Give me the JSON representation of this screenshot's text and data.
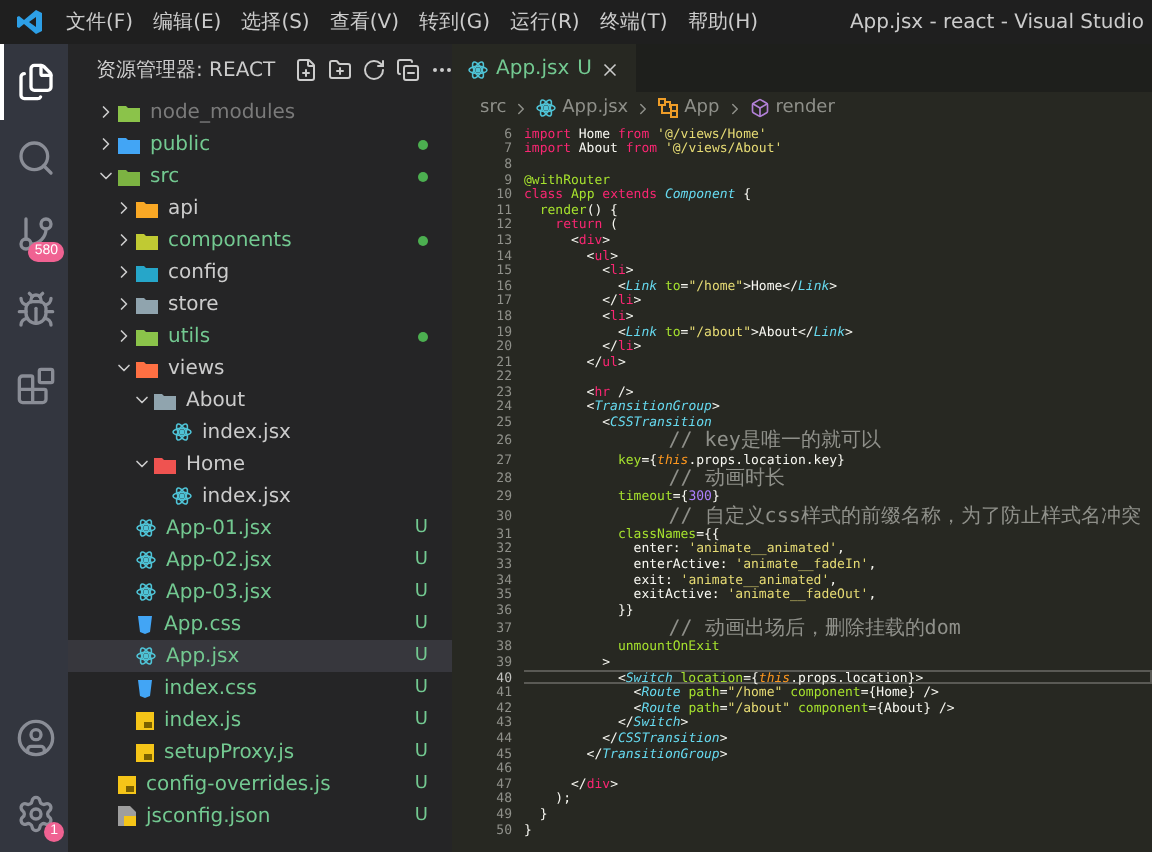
{
  "titlebar": {
    "menu": [
      "文件(F)",
      "编辑(E)",
      "选择(S)",
      "查看(V)",
      "转到(G)",
      "运行(R)",
      "终端(T)",
      "帮助(H)"
    ],
    "title": "App.jsx - react - Visual Studio"
  },
  "activity_bar": {
    "items": [
      {
        "kind": "explorer",
        "selected": true
      },
      {
        "kind": "search",
        "selected": false
      },
      {
        "kind": "source-control",
        "selected": false,
        "badge": "580"
      },
      {
        "kind": "debug",
        "selected": false
      },
      {
        "kind": "extensions",
        "selected": false
      }
    ],
    "bottom": [
      {
        "kind": "account"
      },
      {
        "kind": "settings",
        "badge": "1"
      }
    ]
  },
  "explorer": {
    "title": "资源管理器: REACT",
    "tree": [
      {
        "name": "node_modules",
        "kind": "folder",
        "color": "#8bc34a",
        "ignored": true,
        "changed": false,
        "expanded": false,
        "selected": false
      },
      {
        "name": "public",
        "kind": "folder",
        "color": "#42a5f5",
        "ignored": false,
        "changed": true,
        "expanded": false,
        "selected": false
      },
      {
        "name": "src",
        "kind": "folder",
        "color": "#7cb342",
        "ignored": false,
        "changed": true,
        "expanded": true,
        "selected": false,
        "children": [
          {
            "name": "api",
            "kind": "folder",
            "color": "#f9a825",
            "ignored": false,
            "changed": false,
            "expanded": false,
            "selected": false
          },
          {
            "name": "components",
            "kind": "folder",
            "color": "#c0ca33",
            "ignored": false,
            "changed": true,
            "expanded": false,
            "selected": false
          },
          {
            "name": "config",
            "kind": "folder",
            "color": "#26a6c9",
            "ignored": false,
            "changed": false,
            "expanded": false,
            "selected": false
          },
          {
            "name": "store",
            "kind": "folder",
            "color": "#90a4ae",
            "ignored": false,
            "changed": false,
            "expanded": false,
            "selected": false
          },
          {
            "name": "utils",
            "kind": "folder",
            "color": "#8bc34a",
            "ignored": false,
            "changed": true,
            "expanded": false,
            "selected": false
          },
          {
            "name": "views",
            "kind": "folder",
            "color": "#ff7043",
            "ignored": false,
            "changed": false,
            "expanded": true,
            "selected": false,
            "children": [
              {
                "name": "About",
                "kind": "folder",
                "color": "#90a4ae",
                "ignored": false,
                "changed": false,
                "expanded": true,
                "selected": false,
                "children": [
                  {
                    "name": "index.jsx",
                    "kind": "react",
                    "ignored": false,
                    "changed": false,
                    "selected": false
                  }
                ]
              },
              {
                "name": "Home",
                "kind": "folder",
                "color": "#ef5350",
                "ignored": false,
                "changed": false,
                "expanded": true,
                "selected": false,
                "children": [
                  {
                    "name": "index.jsx",
                    "kind": "react",
                    "ignored": false,
                    "changed": false,
                    "selected": false
                  }
                ]
              }
            ]
          },
          {
            "name": "App-01.jsx",
            "kind": "react",
            "ignored": false,
            "changed": true,
            "badge": "U",
            "selected": false
          },
          {
            "name": "App-02.jsx",
            "kind": "react",
            "ignored": false,
            "changed": true,
            "badge": "U",
            "selected": false
          },
          {
            "name": "App-03.jsx",
            "kind": "react",
            "ignored": false,
            "changed": true,
            "badge": "U",
            "selected": false
          },
          {
            "name": "App.css",
            "kind": "css",
            "ignored": false,
            "changed": true,
            "badge": "U",
            "selected": false
          },
          {
            "name": "App.jsx",
            "kind": "react",
            "ignored": false,
            "changed": true,
            "badge": "U",
            "selected": true
          },
          {
            "name": "index.css",
            "kind": "css",
            "ignored": false,
            "changed": true,
            "badge": "U",
            "selected": false
          },
          {
            "name": "index.js",
            "kind": "js",
            "ignored": false,
            "changed": true,
            "badge": "U",
            "selected": false
          },
          {
            "name": "setupProxy.js",
            "kind": "js",
            "ignored": false,
            "changed": true,
            "badge": "U",
            "selected": false
          }
        ]
      },
      {
        "name": "config-overrides.js",
        "kind": "js",
        "ignored": false,
        "changed": true,
        "badge": "U",
        "selected": false
      },
      {
        "name": "jsconfig.json",
        "kind": "json",
        "ignored": false,
        "changed": true,
        "badge": "U",
        "selected": false
      }
    ]
  },
  "editor": {
    "tabs": [
      {
        "label": "App.jsx",
        "badge": "U",
        "selected": true
      }
    ],
    "breadcrumb": [
      {
        "kind": "folder",
        "label": "src"
      },
      {
        "kind": "react",
        "label": "App.jsx"
      },
      {
        "kind": "class",
        "label": "App"
      },
      {
        "kind": "method",
        "label": "render"
      }
    ],
    "lines": [
      {
        "n": "6",
        "current": false,
        "tokens": [
          {
            "kind": "kw",
            "text": "import"
          },
          {
            "kind": "plain",
            "text": " Home "
          },
          {
            "kind": "kw",
            "text": "from"
          },
          {
            "kind": "str",
            "text": " '@/views/Home'"
          }
        ]
      },
      {
        "n": "7",
        "current": false,
        "tokens": [
          {
            "kind": "kw",
            "text": "import"
          },
          {
            "kind": "plain",
            "text": " About "
          },
          {
            "kind": "kw",
            "text": "from"
          },
          {
            "kind": "str",
            "text": " '@/views/About'"
          }
        ]
      },
      {
        "n": "8",
        "current": false
      },
      {
        "n": "9",
        "current": false,
        "tokens": [
          {
            "kind": "deco",
            "text": "@withRouter"
          }
        ]
      },
      {
        "n": "10",
        "current": false,
        "tokens": [
          {
            "kind": "kw",
            "text": "class"
          },
          {
            "kind": "cls",
            "text": " App "
          },
          {
            "kind": "kw",
            "text": "extends"
          },
          {
            "kind": "comp",
            "text": " Component"
          },
          {
            "kind": "plain",
            "text": " {"
          }
        ]
      },
      {
        "n": "11",
        "current": false,
        "tokens": [
          {
            "kind": "fn",
            "text": "  render"
          },
          {
            "kind": "plain",
            "text": "() {"
          }
        ]
      },
      {
        "n": "12",
        "current": false,
        "tokens": [
          {
            "kind": "kw",
            "text": "    return"
          },
          {
            "kind": "plain",
            "text": " ("
          }
        ]
      },
      {
        "n": "13",
        "current": false,
        "tokens": [
          {
            "kind": "plain",
            "text": "      <"
          },
          {
            "kind": "tag",
            "text": "div"
          },
          {
            "kind": "plain",
            "text": ">"
          }
        ]
      },
      {
        "n": "14",
        "current": false,
        "tokens": [
          {
            "kind": "plain",
            "text": "        <"
          },
          {
            "kind": "tag",
            "text": "ul"
          },
          {
            "kind": "plain",
            "text": ">"
          }
        ]
      },
      {
        "n": "15",
        "current": false,
        "tokens": [
          {
            "kind": "plain",
            "text": "          <"
          },
          {
            "kind": "tag",
            "text": "li"
          },
          {
            "kind": "plain",
            "text": ">"
          }
        ]
      },
      {
        "n": "16",
        "current": false,
        "tokens": [
          {
            "kind": "plain",
            "text": "            <"
          },
          {
            "kind": "comp",
            "text": "Link"
          },
          {
            "kind": "attr",
            "text": " to"
          },
          {
            "kind": "plain",
            "text": "="
          },
          {
            "kind": "str",
            "text": "\"/home\""
          },
          {
            "kind": "plain",
            "text": ">Home</"
          },
          {
            "kind": "comp",
            "text": "Link"
          },
          {
            "kind": "plain",
            "text": ">"
          }
        ]
      },
      {
        "n": "17",
        "current": false,
        "tokens": [
          {
            "kind": "plain",
            "text": "          </"
          },
          {
            "kind": "tag",
            "text": "li"
          },
          {
            "kind": "plain",
            "text": ">"
          }
        ]
      },
      {
        "n": "18",
        "current": false,
        "tokens": [
          {
            "kind": "plain",
            "text": "          <"
          },
          {
            "kind": "tag",
            "text": "li"
          },
          {
            "kind": "plain",
            "text": ">"
          }
        ]
      },
      {
        "n": "19",
        "current": false,
        "tokens": [
          {
            "kind": "plain",
            "text": "            <"
          },
          {
            "kind": "comp",
            "text": "Link"
          },
          {
            "kind": "attr",
            "text": " to"
          },
          {
            "kind": "plain",
            "text": "="
          },
          {
            "kind": "str",
            "text": "\"/about\""
          },
          {
            "kind": "plain",
            "text": ">About</"
          },
          {
            "kind": "comp",
            "text": "Link"
          },
          {
            "kind": "plain",
            "text": ">"
          }
        ]
      },
      {
        "n": "20",
        "current": false,
        "tokens": [
          {
            "kind": "plain",
            "text": "          </"
          },
          {
            "kind": "tag",
            "text": "li"
          },
          {
            "kind": "plain",
            "text": ">"
          }
        ]
      },
      {
        "n": "21",
        "current": false,
        "tokens": [
          {
            "kind": "plain",
            "text": "        </"
          },
          {
            "kind": "tag",
            "text": "ul"
          },
          {
            "kind": "plain",
            "text": ">"
          }
        ]
      },
      {
        "n": "22",
        "current": false
      },
      {
        "n": "23",
        "current": false,
        "tokens": [
          {
            "kind": "plain",
            "text": "        <"
          },
          {
            "kind": "tag",
            "text": "hr"
          },
          {
            "kind": "plain",
            "text": " />"
          }
        ]
      },
      {
        "n": "24",
        "current": false,
        "tokens": [
          {
            "kind": "plain",
            "text": "        <"
          },
          {
            "kind": "comp",
            "text": "TransitionGroup"
          },
          {
            "kind": "plain",
            "text": ">"
          }
        ]
      },
      {
        "n": "25",
        "current": false,
        "tokens": [
          {
            "kind": "plain",
            "text": "          <"
          },
          {
            "kind": "comp",
            "text": "CSSTransition"
          }
        ]
      },
      {
        "n": "26",
        "current": false,
        "tokens": [
          {
            "kind": "comment",
            "text": "            // key是唯一的就可以"
          }
        ]
      },
      {
        "n": "27",
        "current": false,
        "tokens": [
          {
            "kind": "attr",
            "text": "            key"
          },
          {
            "kind": "plain",
            "text": "={"
          },
          {
            "kind": "this",
            "text": "this"
          },
          {
            "kind": "plain",
            "text": ".props.location.key}"
          }
        ]
      },
      {
        "n": "28",
        "current": false,
        "tokens": [
          {
            "kind": "comment",
            "text": "            // 动画时长"
          }
        ]
      },
      {
        "n": "29",
        "current": false,
        "tokens": [
          {
            "kind": "attr",
            "text": "            timeout"
          },
          {
            "kind": "plain",
            "text": "={"
          },
          {
            "kind": "num",
            "text": "300"
          },
          {
            "kind": "plain",
            "text": "}"
          }
        ]
      },
      {
        "n": "30",
        "current": false,
        "tokens": [
          {
            "kind": "comment",
            "text": "            // 自定义css样式的前缀名称，为了防止样式名冲突"
          }
        ]
      },
      {
        "n": "31",
        "current": false,
        "tokens": [
          {
            "kind": "attr",
            "text": "            classNames"
          },
          {
            "kind": "plain",
            "text": "={{"
          }
        ]
      },
      {
        "n": "32",
        "current": false,
        "tokens": [
          {
            "kind": "plain",
            "text": "              enter: "
          },
          {
            "kind": "str",
            "text": "'animate__animated'"
          },
          {
            "kind": "plain",
            "text": ","
          }
        ]
      },
      {
        "n": "33",
        "current": false,
        "tokens": [
          {
            "kind": "plain",
            "text": "              enterActive: "
          },
          {
            "kind": "str",
            "text": "'animate__fadeIn'"
          },
          {
            "kind": "plain",
            "text": ","
          }
        ]
      },
      {
        "n": "34",
        "current": false,
        "tokens": [
          {
            "kind": "plain",
            "text": "              exit: "
          },
          {
            "kind": "str",
            "text": "'animate__animated'"
          },
          {
            "kind": "plain",
            "text": ","
          }
        ]
      },
      {
        "n": "35",
        "current": false,
        "tokens": [
          {
            "kind": "plain",
            "text": "              exitActive: "
          },
          {
            "kind": "str",
            "text": "'animate__fadeOut'"
          },
          {
            "kind": "plain",
            "text": ","
          }
        ]
      },
      {
        "n": "36",
        "current": false,
        "tokens": [
          {
            "kind": "plain",
            "text": "            }}"
          }
        ]
      },
      {
        "n": "37",
        "current": false,
        "tokens": [
          {
            "kind": "comment",
            "text": "            // 动画出场后，删除挂载的dom"
          }
        ]
      },
      {
        "n": "38",
        "current": false,
        "tokens": [
          {
            "kind": "attr",
            "text": "            unmountOnExit"
          }
        ]
      },
      {
        "n": "39",
        "current": false,
        "tokens": [
          {
            "kind": "plain",
            "text": "          >"
          }
        ]
      },
      {
        "n": "40",
        "current": true,
        "tokens": [
          {
            "kind": "plain",
            "text": "            <"
          },
          {
            "kind": "comp",
            "text": "Switch"
          },
          {
            "kind": "attr",
            "text": " location"
          },
          {
            "kind": "plain",
            "text": "={"
          },
          {
            "kind": "this",
            "text": "this"
          },
          {
            "kind": "plain",
            "text": ".props.location}>"
          }
        ]
      },
      {
        "n": "41",
        "current": false,
        "tokens": [
          {
            "kind": "plain",
            "text": "              <"
          },
          {
            "kind": "comp",
            "text": "Route"
          },
          {
            "kind": "attr",
            "text": " path"
          },
          {
            "kind": "plain",
            "text": "="
          },
          {
            "kind": "str",
            "text": "\"/home\""
          },
          {
            "kind": "attr",
            "text": " component"
          },
          {
            "kind": "plain",
            "text": "={Home} />"
          }
        ]
      },
      {
        "n": "42",
        "current": false,
        "tokens": [
          {
            "kind": "plain",
            "text": "              <"
          },
          {
            "kind": "comp",
            "text": "Route"
          },
          {
            "kind": "attr",
            "text": " path"
          },
          {
            "kind": "plain",
            "text": "="
          },
          {
            "kind": "str",
            "text": "\"/about\""
          },
          {
            "kind": "attr",
            "text": " component"
          },
          {
            "kind": "plain",
            "text": "={About} />"
          }
        ]
      },
      {
        "n": "43",
        "current": false,
        "tokens": [
          {
            "kind": "plain",
            "text": "            </"
          },
          {
            "kind": "comp",
            "text": "Switch"
          },
          {
            "kind": "plain",
            "text": ">"
          }
        ]
      },
      {
        "n": "44",
        "current": false,
        "tokens": [
          {
            "kind": "plain",
            "text": "          </"
          },
          {
            "kind": "comp",
            "text": "CSSTransition"
          },
          {
            "kind": "plain",
            "text": ">"
          }
        ]
      },
      {
        "n": "45",
        "current": false,
        "tokens": [
          {
            "kind": "plain",
            "text": "        </"
          },
          {
            "kind": "comp",
            "text": "TransitionGroup"
          },
          {
            "kind": "plain",
            "text": ">"
          }
        ]
      },
      {
        "n": "46",
        "current": false
      },
      {
        "n": "47",
        "current": false,
        "tokens": [
          {
            "kind": "plain",
            "text": "      </"
          },
          {
            "kind": "tag",
            "text": "div"
          },
          {
            "kind": "plain",
            "text": ">"
          }
        ]
      },
      {
        "n": "48",
        "current": false,
        "tokens": [
          {
            "kind": "plain",
            "text": "    );"
          }
        ]
      },
      {
        "n": "49",
        "current": false,
        "tokens": [
          {
            "kind": "plain",
            "text": "  }"
          }
        ]
      },
      {
        "n": "50",
        "current": false,
        "tokens": [
          {
            "kind": "plain",
            "text": "}"
          }
        ]
      }
    ]
  }
}
